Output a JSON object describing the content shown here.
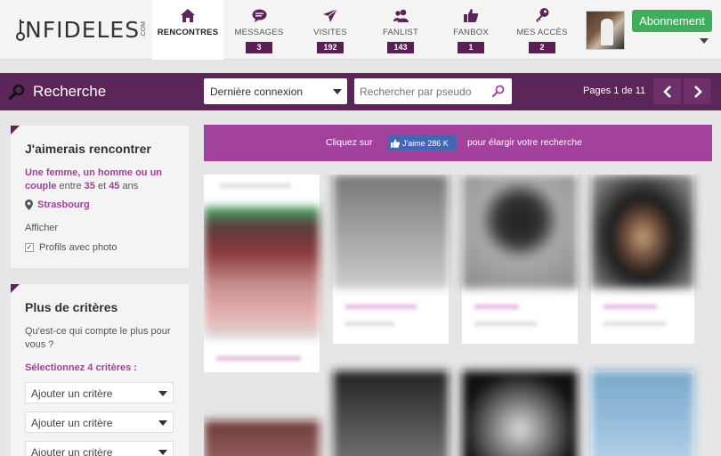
{
  "header": {
    "logo_text": "NFIDELES",
    "logo_suffix": ".COM",
    "nav": [
      {
        "label": "RENCONTRES",
        "badge": "",
        "icon": "home-icon",
        "active": true
      },
      {
        "label": "MESSAGES",
        "badge": "3",
        "icon": "speech-bubble-icon"
      },
      {
        "label": "VISITES",
        "badge": "192",
        "icon": "paper-plane-icon"
      },
      {
        "label": "FANLIST",
        "badge": "143",
        "icon": "users-icon"
      },
      {
        "label": "FANBOX",
        "badge": "1",
        "icon": "thumbs-up-icon"
      },
      {
        "label": "MES ACCÈS",
        "badge": "2",
        "icon": "key-icon"
      }
    ],
    "subscribe_label": "Abonnement"
  },
  "searchbar": {
    "title": "Recherche",
    "sort_selected": "Dernière connexion",
    "pseudo_placeholder": "Rechercher par pseudo",
    "pages_text": "Pages 1 de 11"
  },
  "panel_meet": {
    "title": "J'aimerais rencontrer",
    "desc_hl": "Une femme, un homme ou un couple",
    "desc_mid": " entre ",
    "age_min": "35",
    "desc_and": " et ",
    "age_max": "45",
    "desc_end": " ans",
    "location": "Strasbourg",
    "show_label": "Afficher",
    "photo_label": "Profils avec photo"
  },
  "panel_criteria": {
    "title": "Plus de critères",
    "question": "Qu'est-ce qui compte le plus pour vous ?",
    "select_label": "Sélectionnez 4 critères :",
    "criteria": [
      "Ajouter un critère",
      "Ajouter un critère",
      "Ajouter un critère"
    ]
  },
  "promo": {
    "left_text": "Cliquez sur",
    "like_label": "J'aime 286 K",
    "right_text": "pour élargir votre recherche"
  },
  "colors": {
    "brand_purple": "#5b2557",
    "accent_pink": "#a3419b",
    "subscribe_green": "#3fae5a",
    "facebook_blue": "#4267b2"
  }
}
